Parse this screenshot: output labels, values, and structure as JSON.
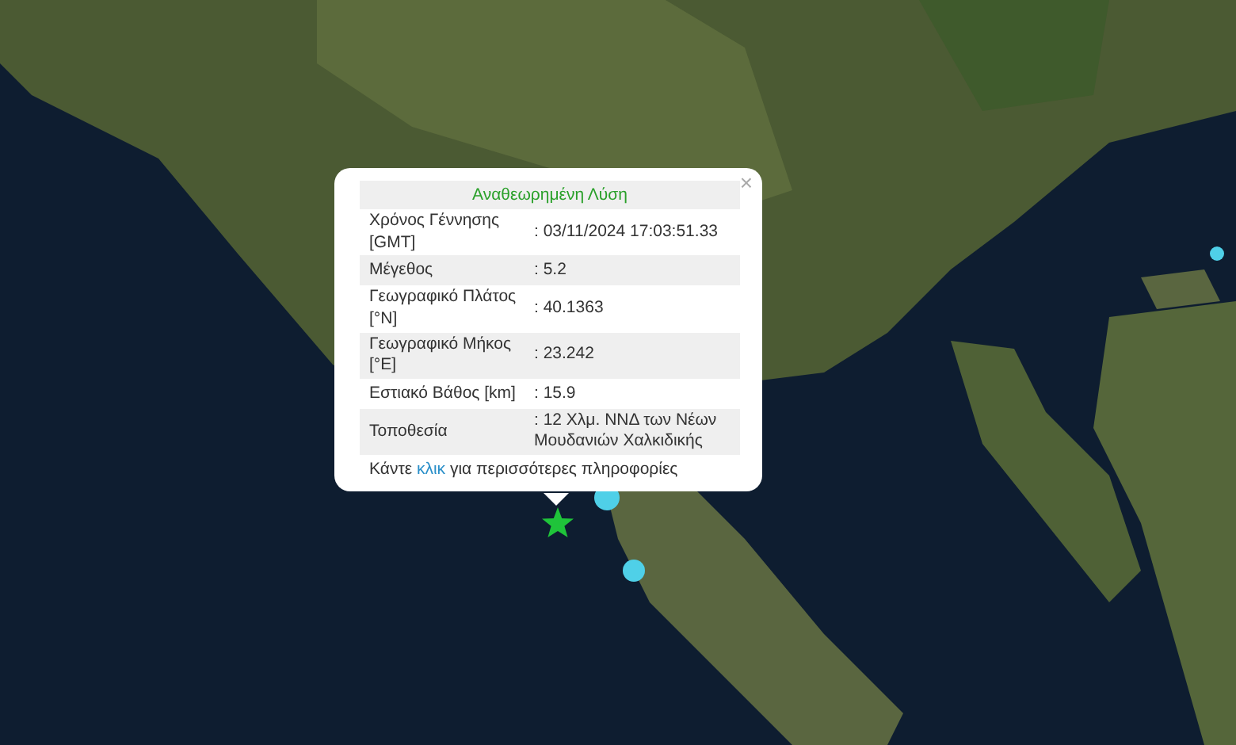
{
  "popup": {
    "title": "Αναθεωρημένη Λύση",
    "close": "×",
    "rows": [
      {
        "label": "Χρόνος Γέννησης [GMT]",
        "value": ": 03/11/2024 17:03:51.33"
      },
      {
        "label": "Μέγεθος",
        "value": ": 5.2"
      },
      {
        "label": "Γεωγραφικό Πλάτος [°N]",
        "value": ": 40.1363"
      },
      {
        "label": "Γεωγραφικό Μήκος [°E]",
        "value": ": 23.242"
      },
      {
        "label": "Εστιακό Βάθος [km]",
        "value": ": 15.9"
      },
      {
        "label": "Τοποθεσία",
        "value": ": 12 Χλμ. ΝΝΔ των Νέων Μουδανιών Χαλκιδικής"
      }
    ],
    "footer": {
      "before": "Κάντε",
      "link": "κλικ",
      "after": "για περισσότερες πληροφορίες"
    }
  }
}
